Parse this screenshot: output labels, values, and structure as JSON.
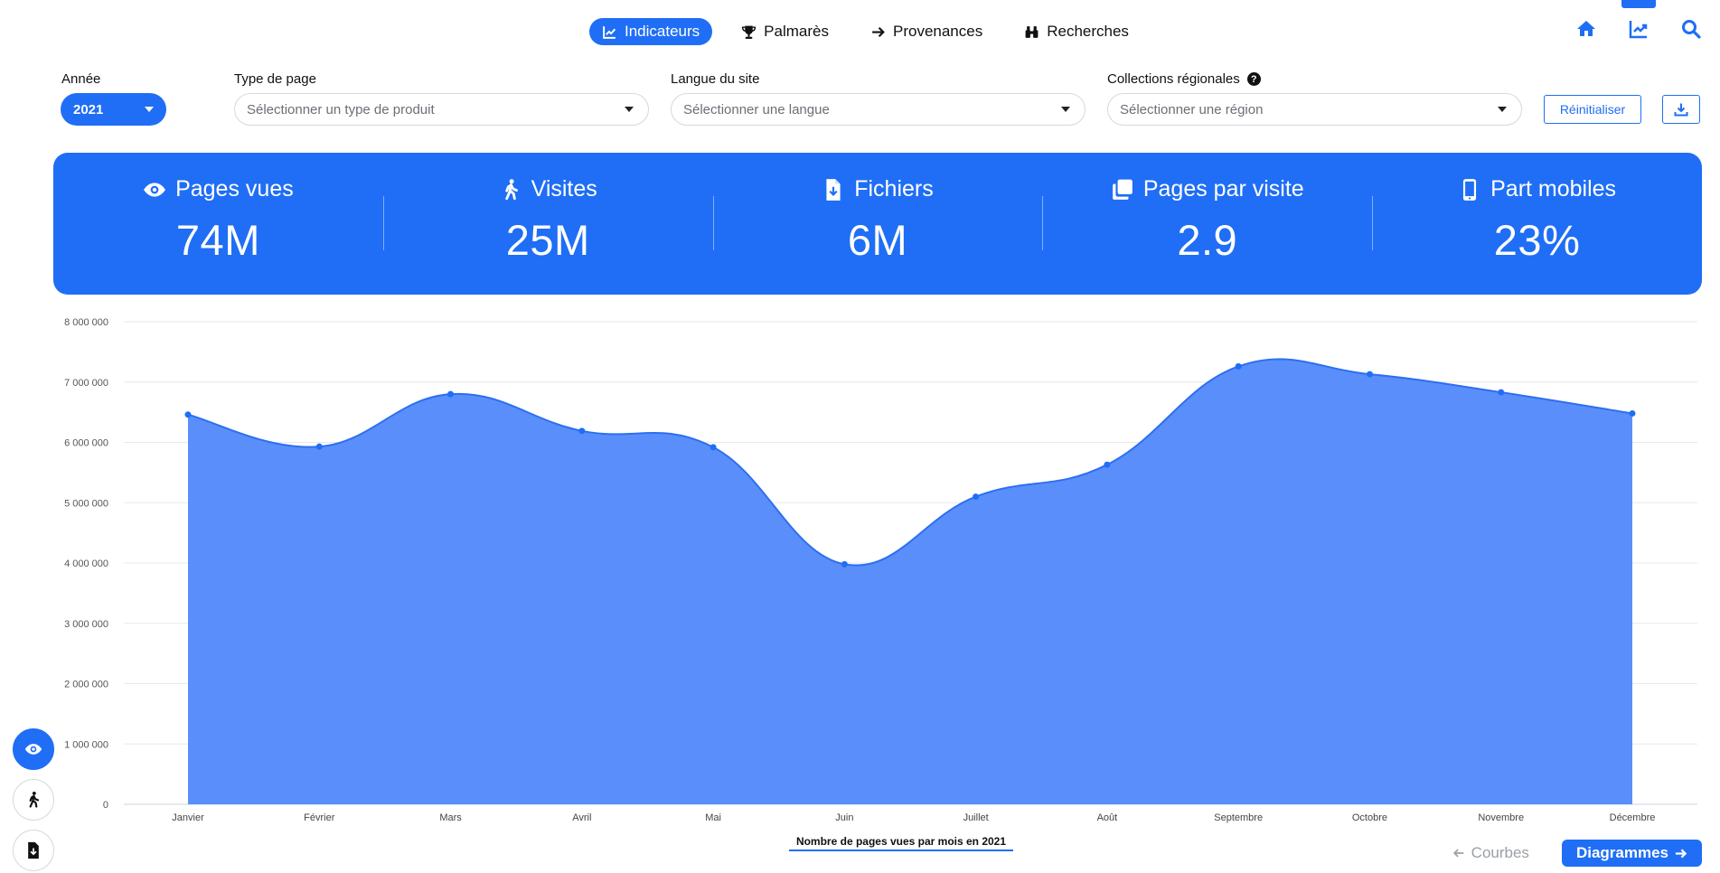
{
  "nav": {
    "tabs": [
      {
        "label": "Indicateurs",
        "icon": "chart-line-icon",
        "active": true
      },
      {
        "label": "Palmarès",
        "icon": "trophy-icon",
        "active": false
      },
      {
        "label": "Provenances",
        "icon": "arrow-right-icon",
        "active": false
      },
      {
        "label": "Recherches",
        "icon": "binoculars-icon",
        "active": false
      }
    ],
    "right_icons": [
      "home-icon",
      "chart-line-icon",
      "search-icon"
    ]
  },
  "filters": {
    "year_label": "Année",
    "year_value": "2021",
    "page_type_label": "Type de page",
    "page_type_placeholder": "Sélectionner un type de produit",
    "language_label": "Langue du site",
    "language_placeholder": "Sélectionner une langue",
    "region_label": "Collections régionales",
    "region_placeholder": "Sélectionner une région",
    "reset_label": "Réinitialiser",
    "download_icon": "download-icon"
  },
  "kpis": [
    {
      "title": "Pages vues",
      "value": "74M",
      "icon": "eye-icon"
    },
    {
      "title": "Visites",
      "value": "25M",
      "icon": "walking-icon"
    },
    {
      "title": "Fichiers",
      "value": "6M",
      "icon": "file-download-icon"
    },
    {
      "title": "Pages par visite",
      "value": "2.9",
      "icon": "copy-icon"
    },
    {
      "title": "Part mobiles",
      "value": "23%",
      "icon": "mobile-icon"
    }
  ],
  "chart_data": {
    "type": "area",
    "title": "Nombre de pages vues par mois en 2021",
    "categories": [
      "Janvier",
      "Février",
      "Mars",
      "Avril",
      "Mai",
      "Juin",
      "Juillet",
      "Août",
      "Septembre",
      "Octobre",
      "Novembre",
      "Décembre"
    ],
    "series": [
      {
        "values": [
          6460000,
          5930000,
          6800000,
          6190000,
          5920000,
          3980000,
          5100000,
          5630000,
          7260000,
          7130000,
          6830000,
          6480000
        ]
      }
    ],
    "ylim": [
      0,
      8000000
    ],
    "yticks": [
      0,
      1000000,
      2000000,
      3000000,
      4000000,
      5000000,
      6000000,
      7000000,
      8000000
    ],
    "ytick_labels": [
      "0",
      "1 000 000",
      "2 000 000",
      "3 000 000",
      "4 000 000",
      "5 000 000",
      "6 000 000",
      "7 000 000",
      "8 000 000"
    ],
    "grid": true,
    "colors": {
      "fill": "#5a8ffb",
      "line": "#2d6ff0",
      "point": "#1f6ef5",
      "grid": "#e6e8eb"
    }
  },
  "side_buttons": [
    {
      "icon": "eye-icon",
      "active": true
    },
    {
      "icon": "walking-icon",
      "active": false
    },
    {
      "icon": "file-download-icon",
      "active": false
    }
  ],
  "bottom_nav": {
    "prev_label": "Courbes",
    "next_label": "Diagrammes"
  },
  "colors": {
    "accent": "#1f6ef5"
  }
}
